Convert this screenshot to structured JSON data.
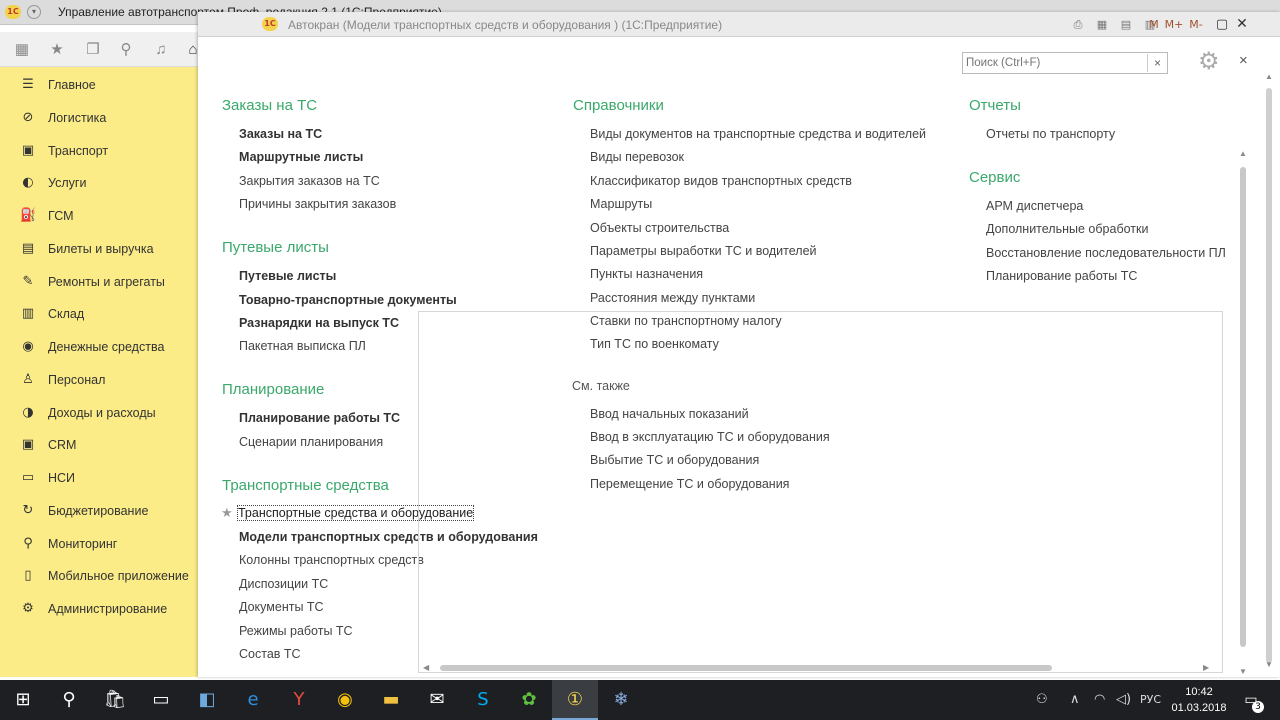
{
  "main_window": {
    "title": "Управление автотранспортом Проф, редакция 2.1 (1С:Предприятие)"
  },
  "sidebar": {
    "items": [
      {
        "label": "Главное",
        "icon": "hamburger-icon"
      },
      {
        "label": "Логистика",
        "icon": "compass-icon"
      },
      {
        "label": "Транспорт",
        "icon": "truck-icon"
      },
      {
        "label": "Услуги",
        "icon": "services-icon"
      },
      {
        "label": "ГСМ",
        "icon": "fuel-icon"
      },
      {
        "label": "Билеты и выручка",
        "icon": "tickets-icon"
      },
      {
        "label": "Ремонты и агрегаты",
        "icon": "wrench-icon"
      },
      {
        "label": "Склад",
        "icon": "warehouse-icon"
      },
      {
        "label": "Денежные средства",
        "icon": "money-icon"
      },
      {
        "label": "Персонал",
        "icon": "person-icon"
      },
      {
        "label": "Доходы и расходы",
        "icon": "income-icon"
      },
      {
        "label": "CRM",
        "icon": "crm-icon"
      },
      {
        "label": "НСИ",
        "icon": "reference-icon"
      },
      {
        "label": "Бюджетирование",
        "icon": "budget-icon"
      },
      {
        "label": "Мониторинг",
        "icon": "monitoring-icon"
      },
      {
        "label": "Мобильное приложение",
        "icon": "mobile-icon"
      },
      {
        "label": "Администрирование",
        "icon": "gear-icon"
      }
    ]
  },
  "window": {
    "title": "Автокран (Модели транспортных средств и оборудования ) (1С:Предприятие)",
    "buttons": [
      "M",
      "M+",
      "M-"
    ]
  },
  "search": {
    "placeholder": "Поиск (Ctrl+F)",
    "clear": "×"
  },
  "close_label": "×",
  "sections": {
    "orders": {
      "title": "Заказы на ТС",
      "items": [
        "Заказы на ТС",
        "Маршрутные листы",
        "Закрытия заказов на ТС",
        "Причины закрытия заказов"
      ]
    },
    "waybills": {
      "title": "Путевые листы",
      "items": [
        "Путевые листы",
        "Товарно-транспортные документы",
        "Разнарядки на выпуск ТС",
        "Пакетная выписка ПЛ"
      ]
    },
    "planning": {
      "title": "Планирование",
      "items": [
        "Планирование работы ТС",
        "Сценарии планирования"
      ]
    },
    "vehicles": {
      "title": "Транспортные средства",
      "items": [
        "Транспортные средства и оборудование",
        "Модели транспортных средств и оборудования",
        "Колонны транспортных средств",
        "Диспозиции ТС",
        "Документы ТС",
        "Режимы работы ТС",
        "Состав ТС"
      ]
    },
    "references": {
      "title": "Справочники",
      "items": [
        "Виды документов на транспортные средства и водителей",
        "Виды перевозок",
        "Классификатор видов транспортных средств",
        "Маршруты",
        "Объекты строительства",
        "Параметры выработки ТС и водителей",
        "Пункты назначения",
        "Расстояния между пунктами",
        "Ставки по транспортному налогу",
        "Тип ТС по военкомату"
      ]
    },
    "see_also": {
      "title": "См. также",
      "items": [
        "Ввод начальных показаний",
        "Ввод в эксплуатацию ТС и оборудования",
        "Выбытие ТС и оборудования",
        "Перемещение ТС и оборудования"
      ]
    },
    "reports": {
      "title": "Отчеты",
      "items": [
        "Отчеты по транспорту"
      ]
    },
    "service": {
      "title": "Сервис",
      "items": [
        "АРМ диспетчера",
        "Дополнительные обработки",
        "Восстановление последовательности ПЛ",
        "Планирование работы ТС"
      ]
    }
  },
  "taskbar": {
    "language": "РУС",
    "time": "10:42",
    "date": "01.03.2018",
    "notifications": "3"
  },
  "colors": {
    "sidebar_bg": "#fbec88",
    "section_title": "#3ba86c",
    "taskbar_bg": "#1d1f22"
  }
}
